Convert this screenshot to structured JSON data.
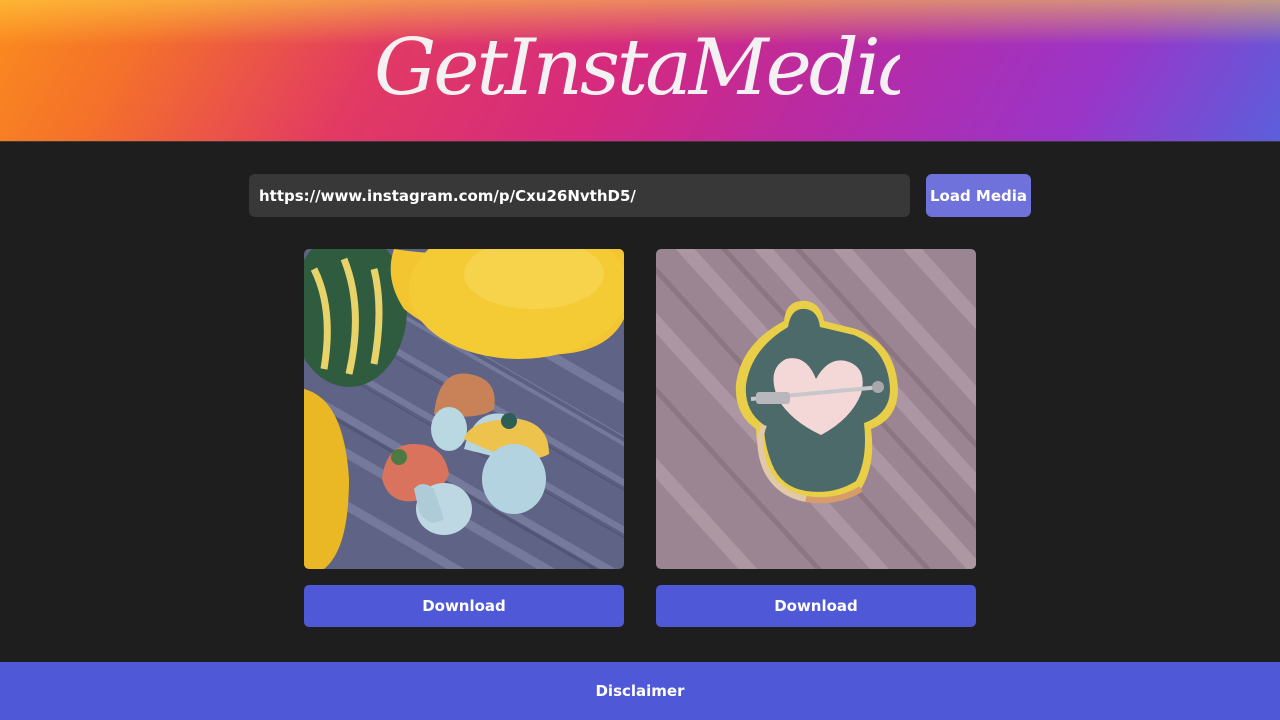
{
  "header": {
    "logo_text": "GetInstaMedia"
  },
  "search": {
    "url_value": "https://www.instagram.com/p/Cxu26NvthD5/",
    "load_label": "Load Media"
  },
  "media": [
    {
      "download_label": "Download"
    },
    {
      "download_label": "Download"
    }
  ],
  "footer": {
    "disclaimer_label": "Disclaimer"
  },
  "colors": {
    "background": "#1e1e1e",
    "input_bg": "#383838",
    "load_button": "#6f72db",
    "primary": "#4f58d6",
    "header_gradient": [
      "#fb8c1e",
      "#e23a63",
      "#d52a7e",
      "#9a35c8",
      "#5b5fdc"
    ]
  }
}
